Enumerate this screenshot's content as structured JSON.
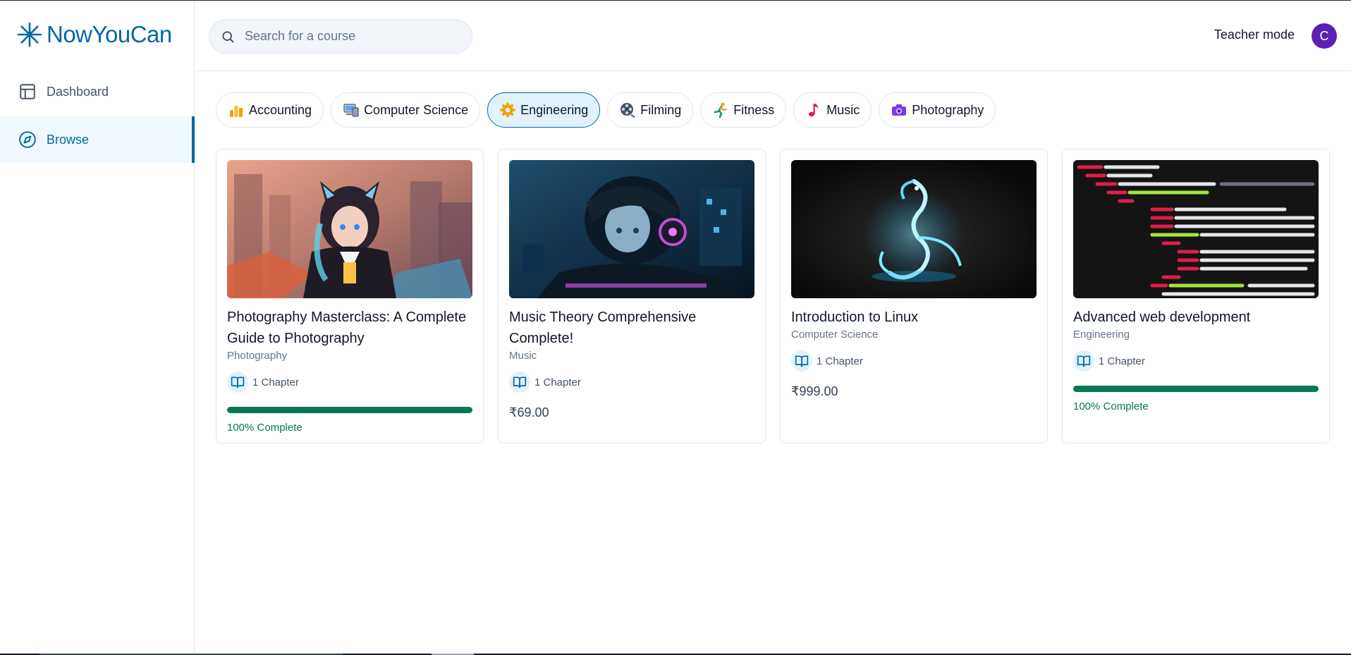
{
  "app": {
    "name": "NowYouCan"
  },
  "sidebar": {
    "items": [
      {
        "label": "Dashboard",
        "icon": "layout-icon",
        "active": false
      },
      {
        "label": "Browse",
        "icon": "compass-icon",
        "active": true
      }
    ]
  },
  "header": {
    "search_placeholder": "Search for a course",
    "teacher_mode": "Teacher mode",
    "avatar_initial": "C"
  },
  "categories": [
    {
      "label": "Accounting",
      "icon": "bar-chart-icon",
      "selected": false
    },
    {
      "label": "Computer Science",
      "icon": "computer-icon",
      "selected": false
    },
    {
      "label": "Engineering",
      "icon": "gear-icon",
      "selected": true
    },
    {
      "label": "Filming",
      "icon": "film-reel-icon",
      "selected": false
    },
    {
      "label": "Fitness",
      "icon": "running-person-icon",
      "selected": false
    },
    {
      "label": "Music",
      "icon": "music-note-icon",
      "selected": false
    },
    {
      "label": "Photography",
      "icon": "camera-icon",
      "selected": false
    }
  ],
  "courses": [
    {
      "title": "Photography Masterclass: A Complete Guide to Photography",
      "category": "Photography",
      "chapters": "1 Chapter",
      "progress": 1.0,
      "progress_label": "100% Complete",
      "price": null
    },
    {
      "title": "Music Theory Comprehensive Complete!",
      "category": "Music",
      "chapters": "1 Chapter",
      "progress": null,
      "progress_label": null,
      "price": "₹69.00"
    },
    {
      "title": "Introduction to Linux",
      "category": "Computer Science",
      "chapters": "1 Chapter",
      "progress": null,
      "progress_label": null,
      "price": "₹999.00"
    },
    {
      "title": "Advanced web development",
      "category": "Engineering",
      "chapters": "1 Chapter",
      "progress": 1.0,
      "progress_label": "100% Complete",
      "price": null
    }
  ],
  "colors": {
    "brand": "#0369a1",
    "progress": "#047857",
    "avatar": "#5b21b6"
  }
}
